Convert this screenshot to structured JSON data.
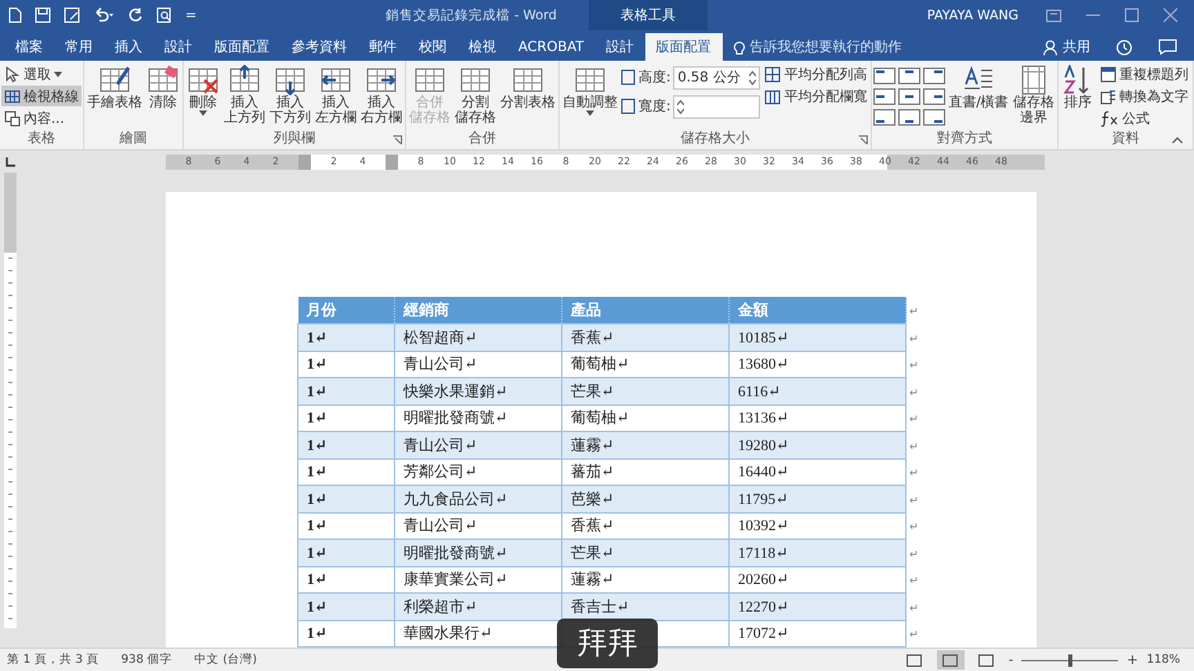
{
  "title_bar": {
    "title": "銷售交易記錄完成檔 - Word",
    "context_title": "表格工具",
    "user": "PAYAYA WANG",
    "qat_more": "="
  },
  "tabs": [
    {
      "label": "檔案",
      "selected": false
    },
    {
      "label": "常用",
      "selected": false
    },
    {
      "label": "插入",
      "selected": false
    },
    {
      "label": "設計",
      "selected": false
    },
    {
      "label": "版面配置",
      "selected": false
    },
    {
      "label": "參考資料",
      "selected": false
    },
    {
      "label": "郵件",
      "selected": false
    },
    {
      "label": "校閱",
      "selected": false
    },
    {
      "label": "檢視",
      "selected": false
    },
    {
      "label": "ACROBAT",
      "selected": false
    },
    {
      "label": "設計",
      "selected": false
    },
    {
      "label": "版面配置",
      "selected": true
    }
  ],
  "tell_me": {
    "placeholder": "告訴我您想要執行的動作"
  },
  "share": {
    "label": "共用"
  },
  "ribbon": {
    "groups": [
      {
        "label": "表格",
        "launcher": false,
        "items": [
          {
            "kind": "small",
            "label": "選取",
            "dropdown": true,
            "on": false
          },
          {
            "kind": "small",
            "label": "檢視格線",
            "dropdown": false,
            "on": true
          },
          {
            "kind": "small",
            "label": "內容...",
            "dropdown": false,
            "on": false
          }
        ]
      },
      {
        "label": "繪圖",
        "launcher": false,
        "items": [
          {
            "kind": "large",
            "label": "手繪表格",
            "dropdown": false,
            "disabled": false
          },
          {
            "kind": "large",
            "label": "清除",
            "dropdown": false,
            "disabled": false
          }
        ]
      },
      {
        "label": "列與欄",
        "launcher": true,
        "items": [
          {
            "kind": "large",
            "label": "刪除",
            "dropdown": true,
            "disabled": false
          },
          {
            "kind": "large",
            "label": [
              "插入",
              "上方列"
            ],
            "dropdown": false,
            "disabled": false
          },
          {
            "kind": "large",
            "label": [
              "插入",
              "下方列"
            ],
            "dropdown": false,
            "disabled": false
          },
          {
            "kind": "large",
            "label": [
              "插入",
              "左方欄"
            ],
            "dropdown": false,
            "disabled": false
          },
          {
            "kind": "large",
            "label": [
              "插入",
              "右方欄"
            ],
            "dropdown": false,
            "disabled": false
          }
        ]
      },
      {
        "label": "合併",
        "launcher": false,
        "items": [
          {
            "kind": "large",
            "label": [
              "合併",
              "儲存格"
            ],
            "dropdown": false,
            "disabled": true
          },
          {
            "kind": "large",
            "label": [
              "分割",
              "儲存格"
            ],
            "dropdown": false,
            "disabled": false
          },
          {
            "kind": "large",
            "label": "分割表格",
            "dropdown": false,
            "disabled": false
          }
        ]
      },
      {
        "label": "儲存格大小",
        "launcher": true,
        "items": [
          {
            "kind": "large",
            "label": "自動調整",
            "dropdown": true,
            "disabled": false
          },
          {
            "kind": "field",
            "label": "高度:",
            "value": "0.58 公分"
          },
          {
            "kind": "field",
            "label": "寬度:"
          },
          {
            "kind": "small",
            "label": "平均分配列高",
            "dropdown": false,
            "on": false
          },
          {
            "kind": "small",
            "label": "平均分配欄寬",
            "dropdown": false,
            "on": false
          }
        ]
      },
      {
        "label": "對齊方式",
        "launcher": false,
        "items": [
          {
            "kind": "align"
          },
          {
            "kind": "large",
            "label": "直書/橫書",
            "dropdown": false,
            "disabled": false
          },
          {
            "kind": "large",
            "label": [
              "儲存格",
              "邊界"
            ],
            "dropdown": false,
            "disabled": false
          }
        ]
      },
      {
        "label": "資料",
        "launcher": false,
        "items": [
          {
            "kind": "large",
            "label": "排序",
            "dropdown": false,
            "disabled": false
          },
          {
            "kind": "small",
            "label": "重複標題列",
            "dropdown": false,
            "on": false
          },
          {
            "kind": "small",
            "label": "轉換為文字",
            "dropdown": false,
            "on": false
          },
          {
            "kind": "small",
            "label": "公式",
            "dropdown": false,
            "on": false
          }
        ]
      }
    ]
  },
  "ruler": {
    "ticks": [
      {
        "kind": "number",
        "label": "8"
      },
      {
        "kind": "number",
        "label": "6"
      },
      {
        "kind": "number",
        "label": "4"
      },
      {
        "kind": "number",
        "label": "2"
      },
      {
        "kind": "marker"
      },
      {
        "kind": "number",
        "label": "2"
      },
      {
        "kind": "number",
        "label": "4"
      },
      {
        "kind": "marker"
      },
      {
        "kind": "number",
        "label": "8"
      },
      {
        "kind": "number",
        "label": "10"
      },
      {
        "kind": "number",
        "label": "12"
      },
      {
        "kind": "number",
        "label": "14"
      },
      {
        "kind": "number",
        "label": "16"
      },
      {
        "kind": "number",
        "label": "8"
      },
      {
        "kind": "number",
        "label": "20"
      },
      {
        "kind": "number",
        "label": "22"
      },
      {
        "kind": "number",
        "label": "24"
      },
      {
        "kind": "number",
        "label": "26"
      },
      {
        "kind": "number",
        "label": "28"
      },
      {
        "kind": "number",
        "label": "30"
      },
      {
        "kind": "number",
        "label": "32"
      },
      {
        "kind": "number",
        "label": "34"
      },
      {
        "kind": "number",
        "label": "36"
      },
      {
        "kind": "number",
        "label": "38"
      },
      {
        "kind": "number",
        "label": "40"
      },
      {
        "kind": "number",
        "label": "42"
      },
      {
        "kind": "number",
        "label": "44"
      },
      {
        "kind": "number",
        "label": "46"
      },
      {
        "kind": "number",
        "label": "48"
      }
    ]
  },
  "table": {
    "columns": [
      "月份",
      "經銷商",
      "產品",
      "金額"
    ],
    "header_end": "↵",
    "rows": [
      {
        "cells": [
          "1↵",
          "松智超商↵",
          "香蕉↵",
          "10185↵"
        ],
        "end": "↵"
      },
      {
        "cells": [
          "1↵",
          "青山公司↵",
          "葡萄柚↵",
          "13680↵"
        ],
        "end": "↵"
      },
      {
        "cells": [
          "1↵",
          "快樂水果運銷↵",
          "芒果↵",
          "6116↵"
        ],
        "end": "↵"
      },
      {
        "cells": [
          "1↵",
          "明曜批發商號↵",
          "葡萄柚↵",
          "13136↵"
        ],
        "end": "↵"
      },
      {
        "cells": [
          "1↵",
          "青山公司↵",
          "蓮霧↵",
          "19280↵"
        ],
        "end": "↵"
      },
      {
        "cells": [
          "1↵",
          "芳鄰公司↵",
          "蕃茄↵",
          "16440↵"
        ],
        "end": "↵"
      },
      {
        "cells": [
          "1↵",
          "九九食品公司↵",
          "芭樂↵",
          "11795↵"
        ],
        "end": "↵"
      },
      {
        "cells": [
          "1↵",
          "青山公司↵",
          "香蕉↵",
          "10392↵"
        ],
        "end": "↵"
      },
      {
        "cells": [
          "1↵",
          "明曜批發商號↵",
          "芒果↵",
          "17118↵"
        ],
        "end": "↵"
      },
      {
        "cells": [
          "1↵",
          "康華實業公司↵",
          "蓮霧↵",
          "20260↵"
        ],
        "end": "↵"
      },
      {
        "cells": [
          "1↵",
          "利榮超市↵",
          "香吉士↵",
          "12270↵"
        ],
        "end": "↵"
      },
      {
        "cells": [
          "1↵",
          "華國水果行↵",
          null,
          "17072↵"
        ],
        "end": "↵"
      }
    ]
  },
  "caption": "拜拜",
  "status_bar": {
    "page": "第 1 頁，共 3 頁",
    "words": "938 個字",
    "language": "中文 (台灣)",
    "views": [
      {
        "selected": false
      },
      {
        "selected": true
      },
      {
        "selected": false
      }
    ],
    "zoom_out": "-",
    "zoom_in": "+",
    "zoom": {
      "level": 0.5
    },
    "zoom_text": "118%"
  }
}
